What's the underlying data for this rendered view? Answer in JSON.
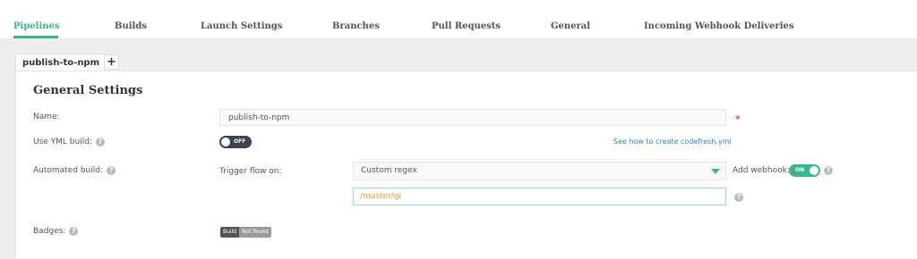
{
  "nav": {
    "items": [
      {
        "label": "Pipelines",
        "active": true
      },
      {
        "label": "Builds"
      },
      {
        "label": "Launch Settings"
      },
      {
        "label": "Branches"
      },
      {
        "label": "Pull Requests"
      },
      {
        "label": "General"
      },
      {
        "label": "Incoming Webhook Deliveries"
      }
    ]
  },
  "tabs": {
    "pipeline": "publish-to-npm",
    "add": "+"
  },
  "settings": {
    "title": "General Settings",
    "name_label": "Name:",
    "name_value": "publish-to-npm",
    "required_mark": "*",
    "yml_label": "Use YML build:",
    "yml_toggle": "OFF",
    "yml_link": "See how to create codefresh.yml",
    "automated_label": "Automated build:",
    "trigger_label": "Trigger flow on:",
    "trigger_value": "Custom regex",
    "webhook_label": "Add webhook:",
    "webhook_toggle": "ON",
    "regex_value": "/master/gi",
    "badges_label": "Badges:",
    "badge_left": "Build",
    "badge_right": "Not found",
    "help_glyph": "?"
  },
  "colors": {
    "accent": "#3ab58b",
    "link": "#2d7ec4",
    "required": "#e74c3c",
    "regex_text": "#e39a3b"
  }
}
